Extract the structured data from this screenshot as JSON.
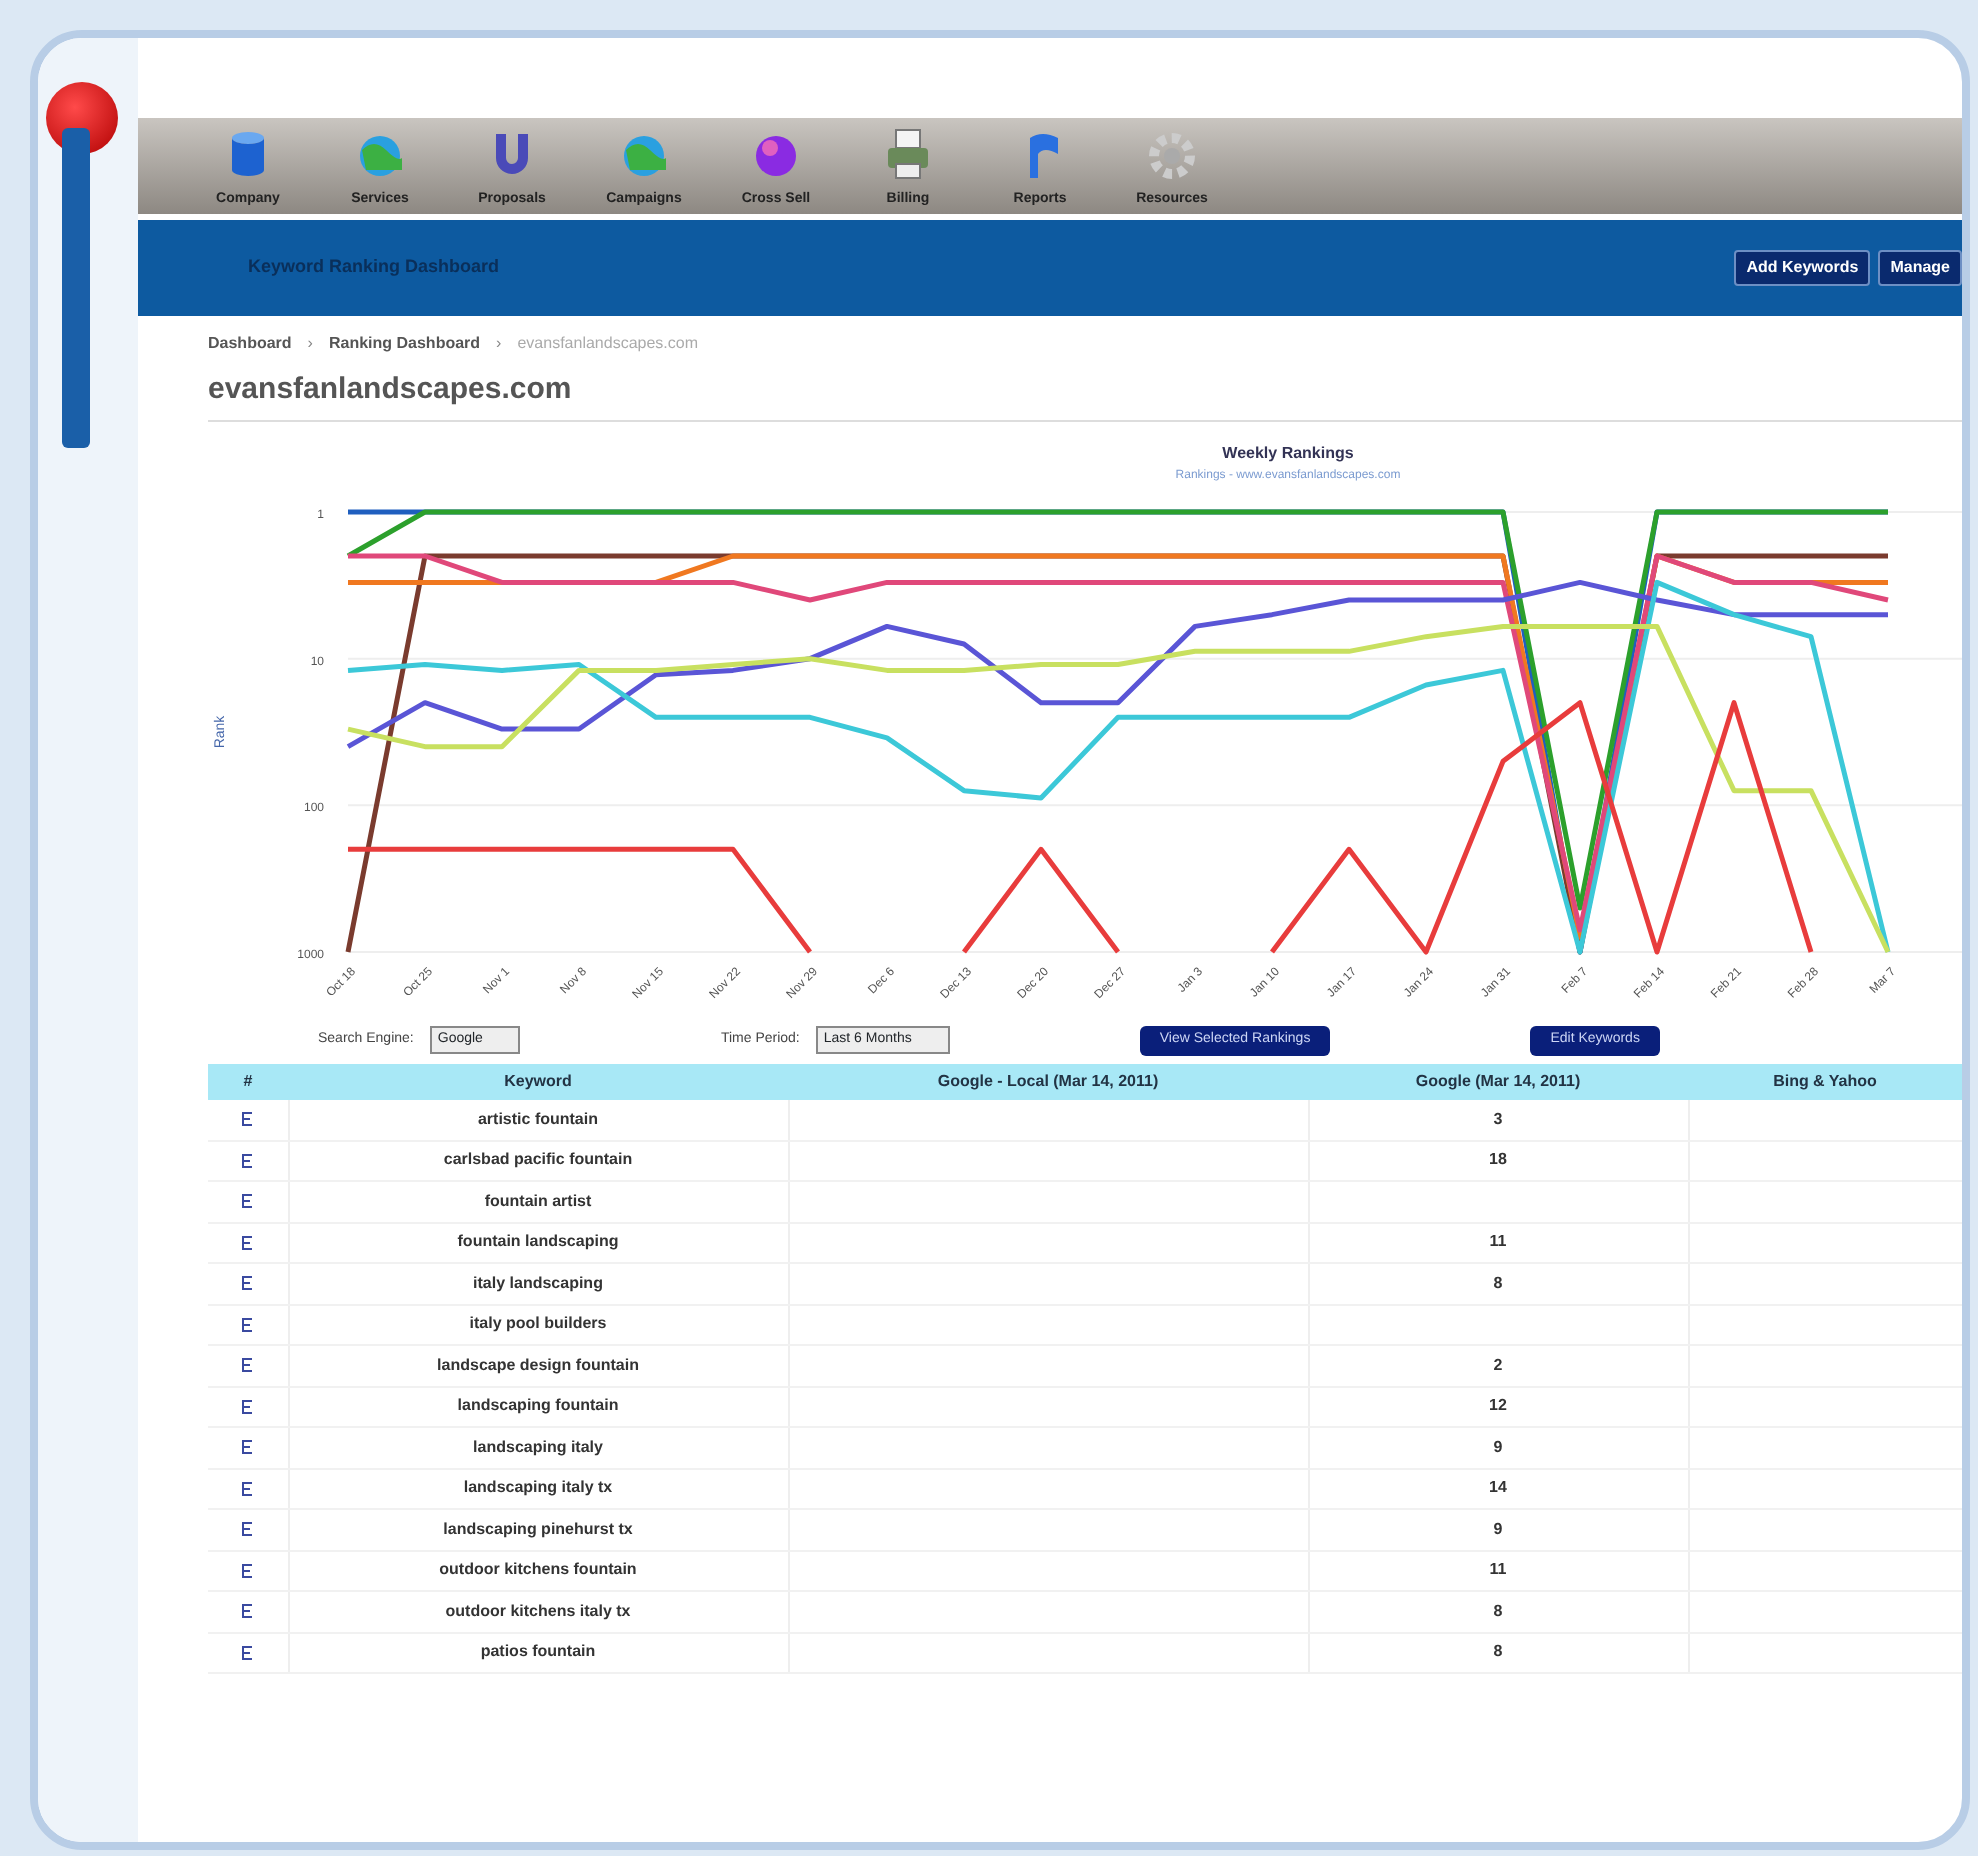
{
  "toolbar": [
    {
      "label": "Company"
    },
    {
      "label": "Services"
    },
    {
      "label": "Proposals"
    },
    {
      "label": "Campaigns"
    },
    {
      "label": "Cross Sell"
    },
    {
      "label": "Billing"
    },
    {
      "label": "Reports"
    },
    {
      "label": "Resources"
    }
  ],
  "header": {
    "title": "Keyword Ranking Dashboard",
    "buttons": [
      "Add Keywords",
      "Manage"
    ]
  },
  "breadcrumb": [
    {
      "kind": "link",
      "label": "Dashboard",
      "current": false
    },
    {
      "kind": "separator",
      "label": "›",
      "current": false
    },
    {
      "kind": "link",
      "label": "Ranking Dashboard",
      "current": false
    },
    {
      "kind": "separator",
      "label": "›",
      "current": false
    },
    {
      "kind": "link",
      "label": "evansfanlandscapes.com",
      "current": true
    }
  ],
  "page_title": "evansfanlandscapes.com",
  "chart": {
    "kind": "picture",
    "title": "Weekly Rankings",
    "subtitle": "Rankings - www.evansfanlandscapes.com",
    "y_axis_title": "Rank",
    "y_labels": [
      "1",
      "10",
      "100",
      "1000"
    ],
    "x_labels": [
      "Oct 18",
      "Oct 25",
      "Nov 1",
      "Nov 8",
      "Nov 15",
      "Nov 22",
      "Nov 29",
      "Dec 6",
      "Dec 13",
      "Dec 20",
      "Dec 27",
      "Jan 3",
      "Jan 10",
      "Jan 17",
      "Jan 24",
      "Jan 31",
      "Feb 7",
      "Feb 14",
      "Feb 21",
      "Feb 28",
      "Mar 7"
    ]
  },
  "filters": [
    {
      "label": "Search Engine:",
      "value": "Google"
    },
    {
      "label": "Time Period:",
      "value": "Last 6 Months"
    }
  ],
  "actions": [
    "View Selected Rankings",
    "Edit Keywords"
  ],
  "table": {
    "columns": [
      "#",
      "Keyword",
      "Google - Local (Mar 14, 2011)",
      "Google (Mar 14, 2011)",
      "Bing & Yahoo"
    ],
    "rows": [
      [
        "artistic fountain",
        "",
        "3"
      ],
      [
        "carlsbad pacific fountain",
        "",
        "18"
      ],
      [
        "fountain artist",
        "",
        ""
      ],
      [
        "fountain landscaping",
        "",
        "11"
      ],
      [
        "italy landscaping",
        "",
        "8"
      ],
      [
        "italy pool builders",
        "",
        ""
      ],
      [
        "landscape design fountain",
        "",
        "2"
      ],
      [
        "landscaping fountain",
        "",
        "12"
      ],
      [
        "landscaping italy",
        "",
        "9"
      ],
      [
        "landscaping italy tx",
        "",
        "14"
      ],
      [
        "landscaping pinehurst tx",
        "",
        "9"
      ],
      [
        "outdoor kitchens fountain",
        "",
        "11"
      ],
      [
        "outdoor kitchens italy tx",
        "",
        "8"
      ],
      [
        "patios fountain",
        "",
        "8"
      ]
    ]
  }
}
